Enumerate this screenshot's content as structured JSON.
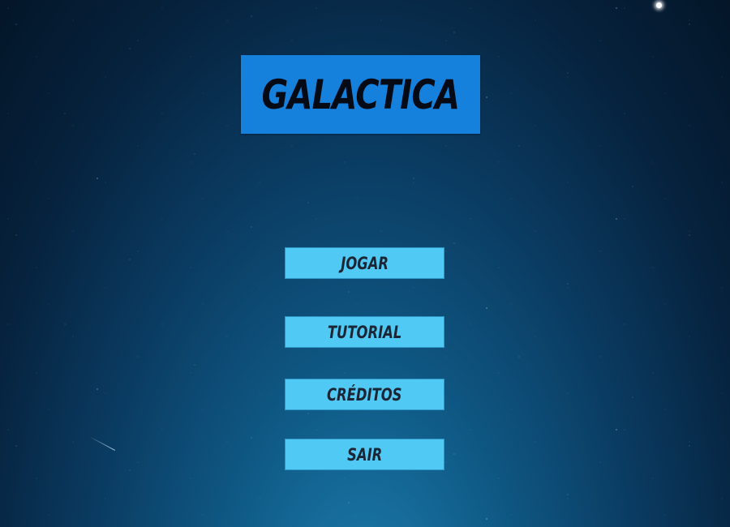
{
  "title": "GALACTICA",
  "menu": {
    "play_label": "JOGAR",
    "tutorial_label": "TUTORIAL",
    "credits_label": "CRÉDITOS",
    "exit_label": "SAIR"
  },
  "colors": {
    "title_bg": "#1680dd",
    "button_bg": "#51c9f5",
    "text": "#1c2533"
  }
}
